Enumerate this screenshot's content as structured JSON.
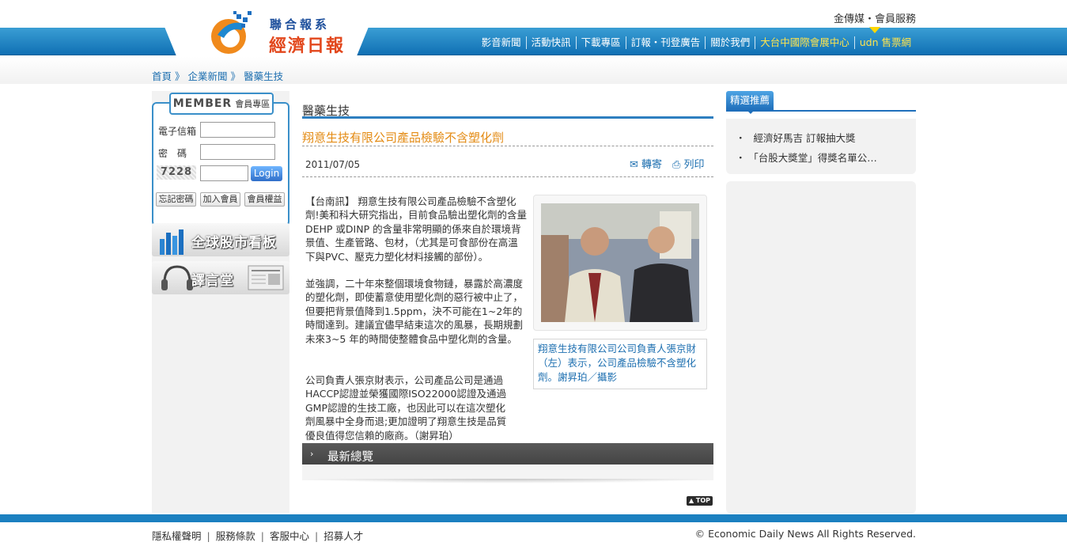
{
  "header": {
    "logo_top": "聯合報系",
    "logo_main": "經濟日報",
    "top_links": "金傳媒・會員服務",
    "nav": [
      {
        "label": "影音新聞",
        "highlight": false
      },
      {
        "label": "活動快訊",
        "highlight": false
      },
      {
        "label": "下載專區",
        "highlight": false
      },
      {
        "label": "訂報・刊登廣告",
        "highlight": false
      },
      {
        "label": "關於我們",
        "highlight": false
      },
      {
        "label": "大台中國際會展中心",
        "highlight": true
      },
      {
        "label": "udn 售票網",
        "highlight": true
      }
    ],
    "brand_blue": "#1070b4",
    "highlight_color": "#ffe44d"
  },
  "breadcrumb": [
    "首頁",
    "企業新聞",
    "醫藥生技"
  ],
  "breadcrumb_sep": "》",
  "member": {
    "title_en": "MEMBER",
    "title_zh": "會員專區",
    "email_label": "電子信箱",
    "password_label": "密　碼",
    "email_value": "",
    "password_value": "",
    "captcha": "7228",
    "captcha_value": "",
    "login_label": "Login",
    "forgot_label": "忘記密碼",
    "join_label": "加入會員",
    "rights_label": "會員權益"
  },
  "banners": {
    "stocks": "全球股市看板",
    "translation": "譯言堂"
  },
  "article": {
    "section": "醫藥生技",
    "title": "翔意生技有限公司產品檢驗不含塑化劑",
    "date": "2011/07/05",
    "forward_label": "轉寄",
    "print_label": "列印",
    "para1": "【台南訊】 翔意生技有限公司產品檢驗不含塑化劑!美和科大研究指出，目前食品驗出塑化劑的含量DEHP 或DINP 的含量非常明顯的係來自於環境背景值、生產管路、包材，（尤其是可食部份在高溫下與PVC、壓克力塑化材料接觸的部份）。",
    "para2": "並強調，二十年來整個環境食物鏈，暴露於高濃度的塑化劑，即使蓄意使用塑化劑的惡行被中止了，但要把背景值降到1.5ppm，決不可能在1~2年的時間達到。建議宜儘早結束這次的風暴，長期規劃未來3~5 年的時間使整體食品中塑化劑的含量。",
    "para3": "公司負責人張京財表示，公司產品公司是通過HACCP認證並榮獲國際ISO22000認證及通過GMP認證的生技工廠，也因此可以在這次塑化劑風暴中全身而退;更加證明了翔意生技是品質優良值得您信賴的廠商。（謝昇珀）",
    "caption": "翔意生技有限公司公司負責人張京財（左）表示，公司產品檢驗不含塑化劑。謝昇珀／攝影",
    "title_color": "#e38a12"
  },
  "latest": {
    "title": "最新總覽"
  },
  "top_button": "TOP",
  "picks": {
    "tab": "精選推薦",
    "items": [
      "經濟好馬吉 訂報抽大獎",
      "「台股大獎堂」得獎名單公…"
    ]
  },
  "footer": {
    "links": [
      "隱私權聲明",
      "服務條款",
      "客服中心",
      "招募人才"
    ],
    "copyright": "© Economic Daily News All Rights Reserved."
  }
}
